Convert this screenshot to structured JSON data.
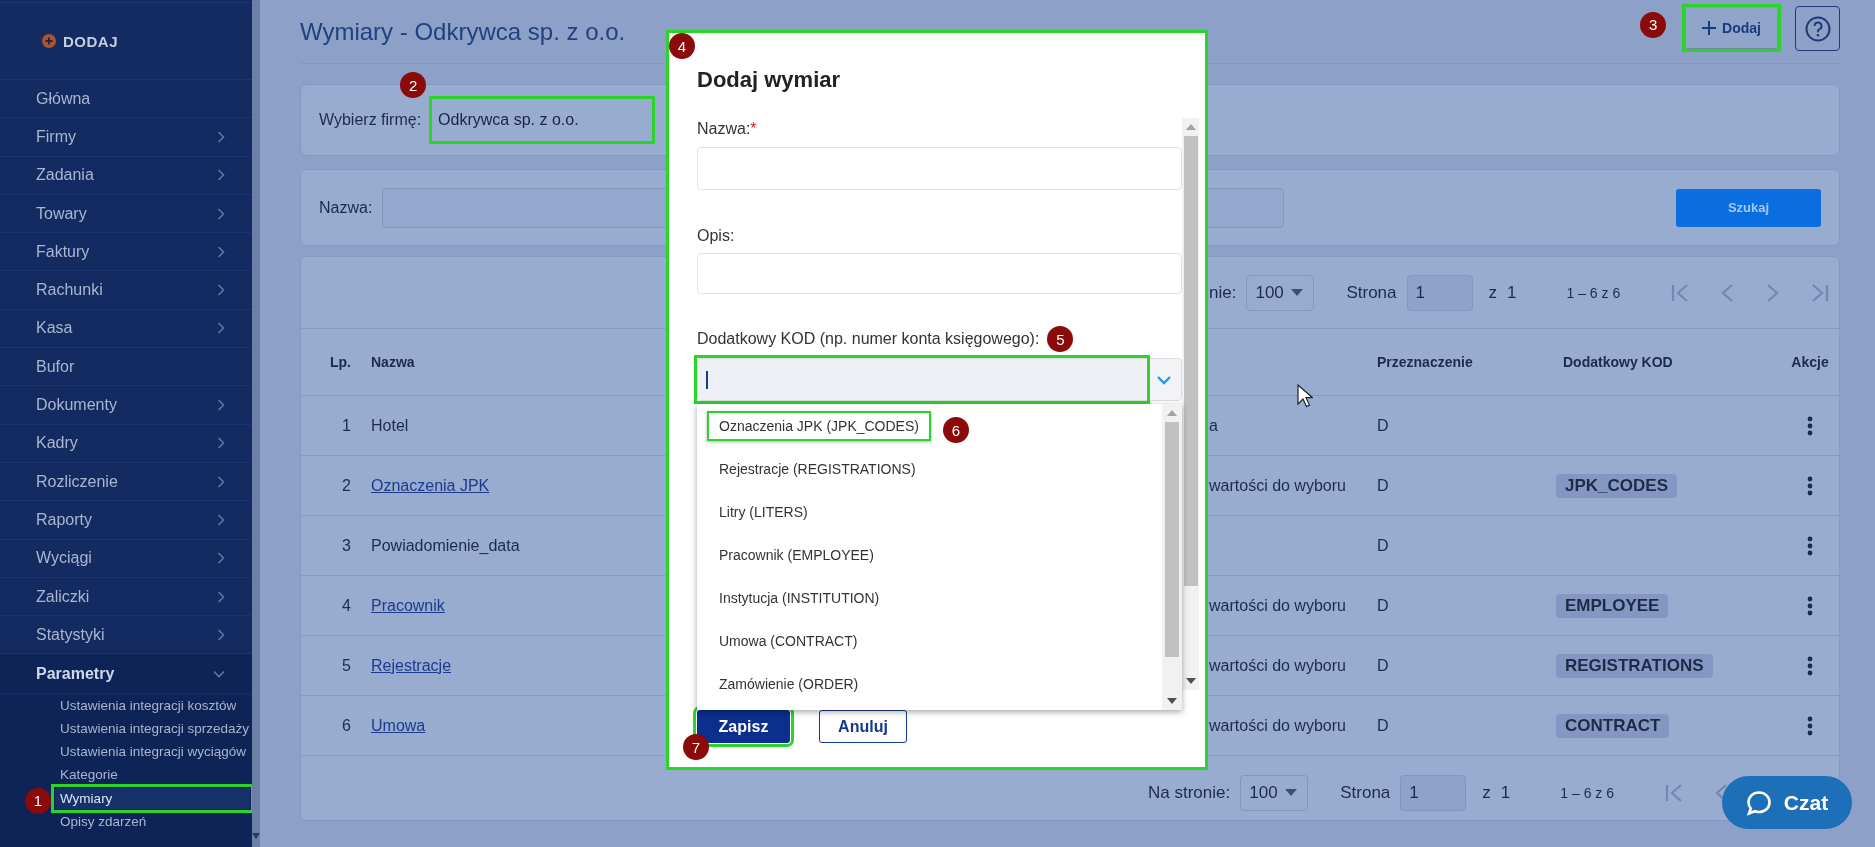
{
  "sidebar": {
    "add_button": "DODAJ",
    "items": [
      {
        "label": "Główna",
        "kind": "link"
      },
      {
        "label": "Firmy",
        "kind": "menu",
        "expanded": false
      },
      {
        "label": "Zadania",
        "kind": "menu",
        "expanded": false
      },
      {
        "label": "Towary",
        "kind": "menu",
        "expanded": false
      },
      {
        "label": "Faktury",
        "kind": "menu",
        "expanded": false
      },
      {
        "label": "Rachunki",
        "kind": "menu",
        "expanded": false
      },
      {
        "label": "Kasa",
        "kind": "menu",
        "expanded": false
      },
      {
        "label": "Bufor",
        "kind": "link"
      },
      {
        "label": "Dokumenty",
        "kind": "menu",
        "expanded": false
      },
      {
        "label": "Kadry",
        "kind": "menu",
        "expanded": false
      },
      {
        "label": "Rozliczenie",
        "kind": "menu",
        "expanded": false
      },
      {
        "label": "Raporty",
        "kind": "menu",
        "expanded": false
      },
      {
        "label": "Wyciągi",
        "kind": "menu",
        "expanded": false
      },
      {
        "label": "Zaliczki",
        "kind": "menu",
        "expanded": false
      },
      {
        "label": "Statystyki",
        "kind": "menu",
        "expanded": false
      },
      {
        "label": "Parametry",
        "kind": "menu",
        "expanded": true,
        "children": [
          {
            "label": "Ustawienia integracji kosztów",
            "selected": false,
            "highlighted": false
          },
          {
            "label": "Ustawienia integracji sprzedaży",
            "selected": false,
            "highlighted": false
          },
          {
            "label": "Ustawienia integracji wyciągów",
            "selected": false,
            "highlighted": false
          },
          {
            "label": "Kategorie",
            "selected": false,
            "highlighted": false
          },
          {
            "label": "Wymiary",
            "selected": true,
            "highlighted": true,
            "callout": "1"
          },
          {
            "label": "Opisy zdarzeń",
            "selected": false,
            "highlighted": false
          }
        ]
      }
    ]
  },
  "header": {
    "title": "Wymiary - Odkrywca sp. z o.o.",
    "add_button": {
      "label": "Dodaj",
      "highlighted": true,
      "callout": "3"
    }
  },
  "company_filter": {
    "label": "Wybierz firmę:",
    "value": "Odkrywca sp. z o.o.",
    "highlighted": true,
    "callout": "2"
  },
  "search": {
    "label": "Nazwa:",
    "button": "Szukaj"
  },
  "table": {
    "pagination_top": {
      "per_page_label": "nie:",
      "per_page": "100",
      "page_label": "Strona",
      "page": "1",
      "of_label": "z",
      "pages": "1",
      "range": "1 – 6 z 6"
    },
    "columns": [
      "Lp.",
      "Nazwa",
      "Przeznaczenie",
      "Dodatkowy KOD",
      "Akcje"
    ],
    "rows": [
      {
        "lp": "1",
        "name": "Hotel",
        "linked": false,
        "column_3": "a",
        "purpose": "D"
      },
      {
        "lp": "2",
        "name": "Oznaczenia JPK",
        "linked": true,
        "column_3": "wartości do wyboru",
        "purpose": "D",
        "code": "JPK_CODES"
      },
      {
        "lp": "3",
        "name": "Powiadomienie_data",
        "linked": false,
        "purpose": "D"
      },
      {
        "lp": "4",
        "name": "Pracownik",
        "linked": true,
        "column_3": "wartości do wyboru",
        "purpose": "D",
        "code": "EMPLOYEE"
      },
      {
        "lp": "5",
        "name": "Rejestracje",
        "linked": true,
        "column_3": "wartości do wyboru",
        "purpose": "D",
        "code": "REGISTRATIONS"
      },
      {
        "lp": "6",
        "name": "Umowa",
        "linked": true,
        "column_3": "wartości do wyboru",
        "purpose": "D",
        "code": "CONTRACT"
      }
    ],
    "pagination_bottom": {
      "per_page_label": "Na stronie:",
      "per_page": "100",
      "page_label": "Strona",
      "page": "1",
      "of_label": "z",
      "pages": "1",
      "range": "1 – 6 z 6"
    }
  },
  "modal": {
    "title": "Dodaj wymiar",
    "highlighted": true,
    "callout": "4",
    "fields": [
      {
        "label": "Nazwa:",
        "required_mark": "*",
        "kind": "text",
        "highlighted": false,
        "focused": false
      },
      {
        "label": "Opis:",
        "kind": "text",
        "highlighted": false,
        "focused": false
      },
      {
        "label": "Dodatkowy KOD (np. numer konta księgowego):",
        "kind": "combobox",
        "highlighted": true,
        "focused": true,
        "callout": "5"
      }
    ],
    "dropdown_options": [
      {
        "label": "Oznaczenia JPK (JPK_CODES)",
        "highlighted": true,
        "callout": "6"
      },
      {
        "label": "Rejestracje (REGISTRATIONS)",
        "highlighted": false
      },
      {
        "label": "Litry (LITERS)",
        "highlighted": false
      },
      {
        "label": "Pracownik (EMPLOYEE)",
        "highlighted": false
      },
      {
        "label": "Instytucja (INSTITUTION)",
        "highlighted": false
      },
      {
        "label": "Umowa (CONTRACT)",
        "highlighted": false
      },
      {
        "label": "Zamówienie (ORDER)",
        "highlighted": false
      }
    ],
    "buttons": [
      {
        "label": "Zapisz",
        "kind": "primary",
        "highlighted": true,
        "callout": "7"
      },
      {
        "label": "Anuluj",
        "kind": "secondary",
        "highlighted": false
      }
    ]
  },
  "chat_button": "Czat"
}
